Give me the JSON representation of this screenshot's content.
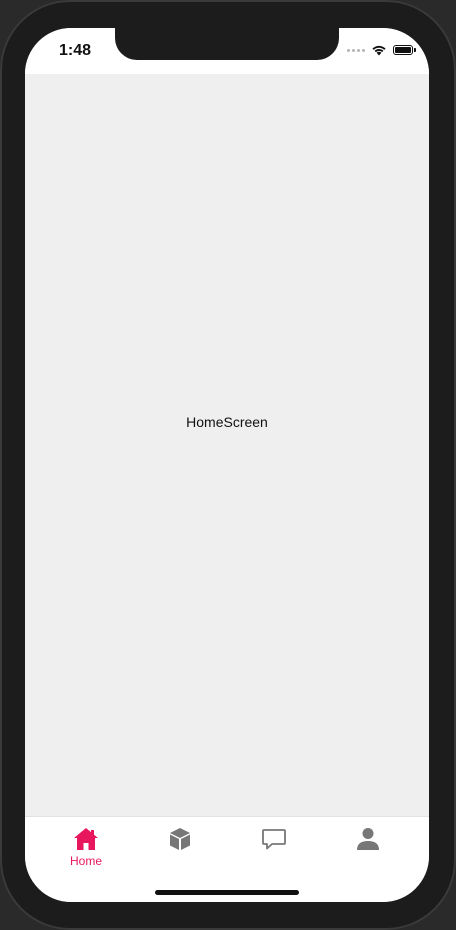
{
  "status_bar": {
    "time": "1:48"
  },
  "main": {
    "screen_title": "HomeScreen"
  },
  "tab_bar": {
    "tabs": [
      {
        "label": "Home",
        "icon": "home-icon",
        "active": true
      },
      {
        "label": "",
        "icon": "box-icon",
        "active": false
      },
      {
        "label": "",
        "icon": "chat-icon",
        "active": false
      },
      {
        "label": "",
        "icon": "user-icon",
        "active": false
      }
    ],
    "active_color": "#e8175d",
    "inactive_color": "#777777"
  }
}
